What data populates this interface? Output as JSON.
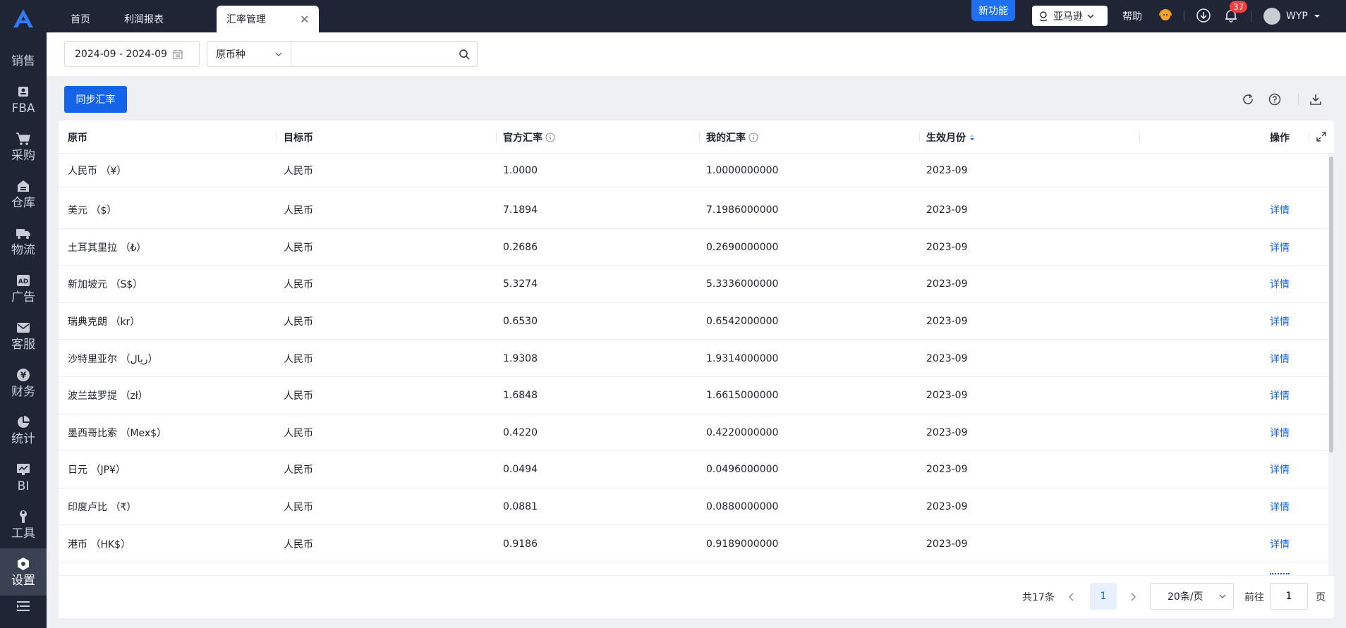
{
  "sidebar": {
    "logo": "A",
    "items": [
      {
        "label": "销售",
        "icon": "sales-icon"
      },
      {
        "label": "FBA",
        "icon": "fba-icon"
      },
      {
        "label": "采购",
        "icon": "cart-icon"
      },
      {
        "label": "仓库",
        "icon": "warehouse-icon"
      },
      {
        "label": "物流",
        "icon": "truck-icon"
      },
      {
        "label": "广告",
        "icon": "ad-icon"
      },
      {
        "label": "客服",
        "icon": "mail-icon"
      },
      {
        "label": "财务",
        "icon": "yuan-icon"
      },
      {
        "label": "统计",
        "icon": "pie-icon"
      },
      {
        "label": "BI",
        "icon": "bi-icon"
      },
      {
        "label": "工具",
        "icon": "wrench-icon"
      },
      {
        "label": "设置",
        "icon": "settings-icon"
      }
    ],
    "active_index": 11
  },
  "topbar": {
    "tabs": [
      {
        "label": "首页"
      },
      {
        "label": "利润报表"
      },
      {
        "label": "汇率管理",
        "active": true
      }
    ],
    "new_feature": "新功能",
    "store": "亚马逊",
    "help": "帮助",
    "notification_count": "37",
    "user": "WYP"
  },
  "filters": {
    "date_range": "2024-09 - 2024-09",
    "currency_select": "原币种",
    "search_placeholder": ""
  },
  "toolbar": {
    "sync_label": "同步汇率"
  },
  "table": {
    "columns": {
      "source": "原币",
      "target": "目标币",
      "official": "官方汇率",
      "mine": "我的汇率",
      "month": "生效月份",
      "action": "操作"
    },
    "rows": [
      {
        "source": "人民币 （¥）",
        "target": "人民币",
        "official": "1.0000",
        "mine": "1.0000000000",
        "month": "2023-09",
        "action": ""
      },
      {
        "source": "美元 （$）",
        "target": "人民币",
        "official": "7.1894",
        "mine": "7.1986000000",
        "month": "2023-09",
        "action": "详情"
      },
      {
        "source": "土耳其里拉 （₺）",
        "target": "人民币",
        "official": "0.2686",
        "mine": "0.2690000000",
        "month": "2023-09",
        "action": "详情"
      },
      {
        "source": "新加坡元 （S$）",
        "target": "人民币",
        "official": "5.3274",
        "mine": "5.3336000000",
        "month": "2023-09",
        "action": "详情"
      },
      {
        "source": "瑞典克朗 （kr）",
        "target": "人民币",
        "official": "0.6530",
        "mine": "0.6542000000",
        "month": "2023-09",
        "action": "详情"
      },
      {
        "source": "沙特里亚尔 （ريال）",
        "target": "人民币",
        "official": "1.9308",
        "mine": "1.9314000000",
        "month": "2023-09",
        "action": "详情"
      },
      {
        "source": "波兰兹罗提 （zł）",
        "target": "人民币",
        "official": "1.6848",
        "mine": "1.6615000000",
        "month": "2023-09",
        "action": "详情"
      },
      {
        "source": "墨西哥比索 （Mex$）",
        "target": "人民币",
        "official": "0.4220",
        "mine": "0.4220000000",
        "month": "2023-09",
        "action": "详情"
      },
      {
        "source": "日元 （JP¥）",
        "target": "人民币",
        "official": "0.0494",
        "mine": "0.0496000000",
        "month": "2023-09",
        "action": "详情"
      },
      {
        "source": "印度卢比 （₹）",
        "target": "人民币",
        "official": "0.0881",
        "mine": "0.0880000000",
        "month": "2023-09",
        "action": "详情"
      },
      {
        "source": "港币 （HK$）",
        "target": "人民币",
        "official": "0.9186",
        "mine": "0.9189000000",
        "month": "2023-09",
        "action": "详情"
      }
    ]
  },
  "pagination": {
    "total": "共17条",
    "current": "1",
    "page_size": "20条/页",
    "goto_label": "前往",
    "goto_value": "1",
    "page_suffix": "页"
  },
  "colors": {
    "accent": "#1463e8",
    "sidebar_bg": "#1f2535",
    "badge": "#f53f3f"
  }
}
